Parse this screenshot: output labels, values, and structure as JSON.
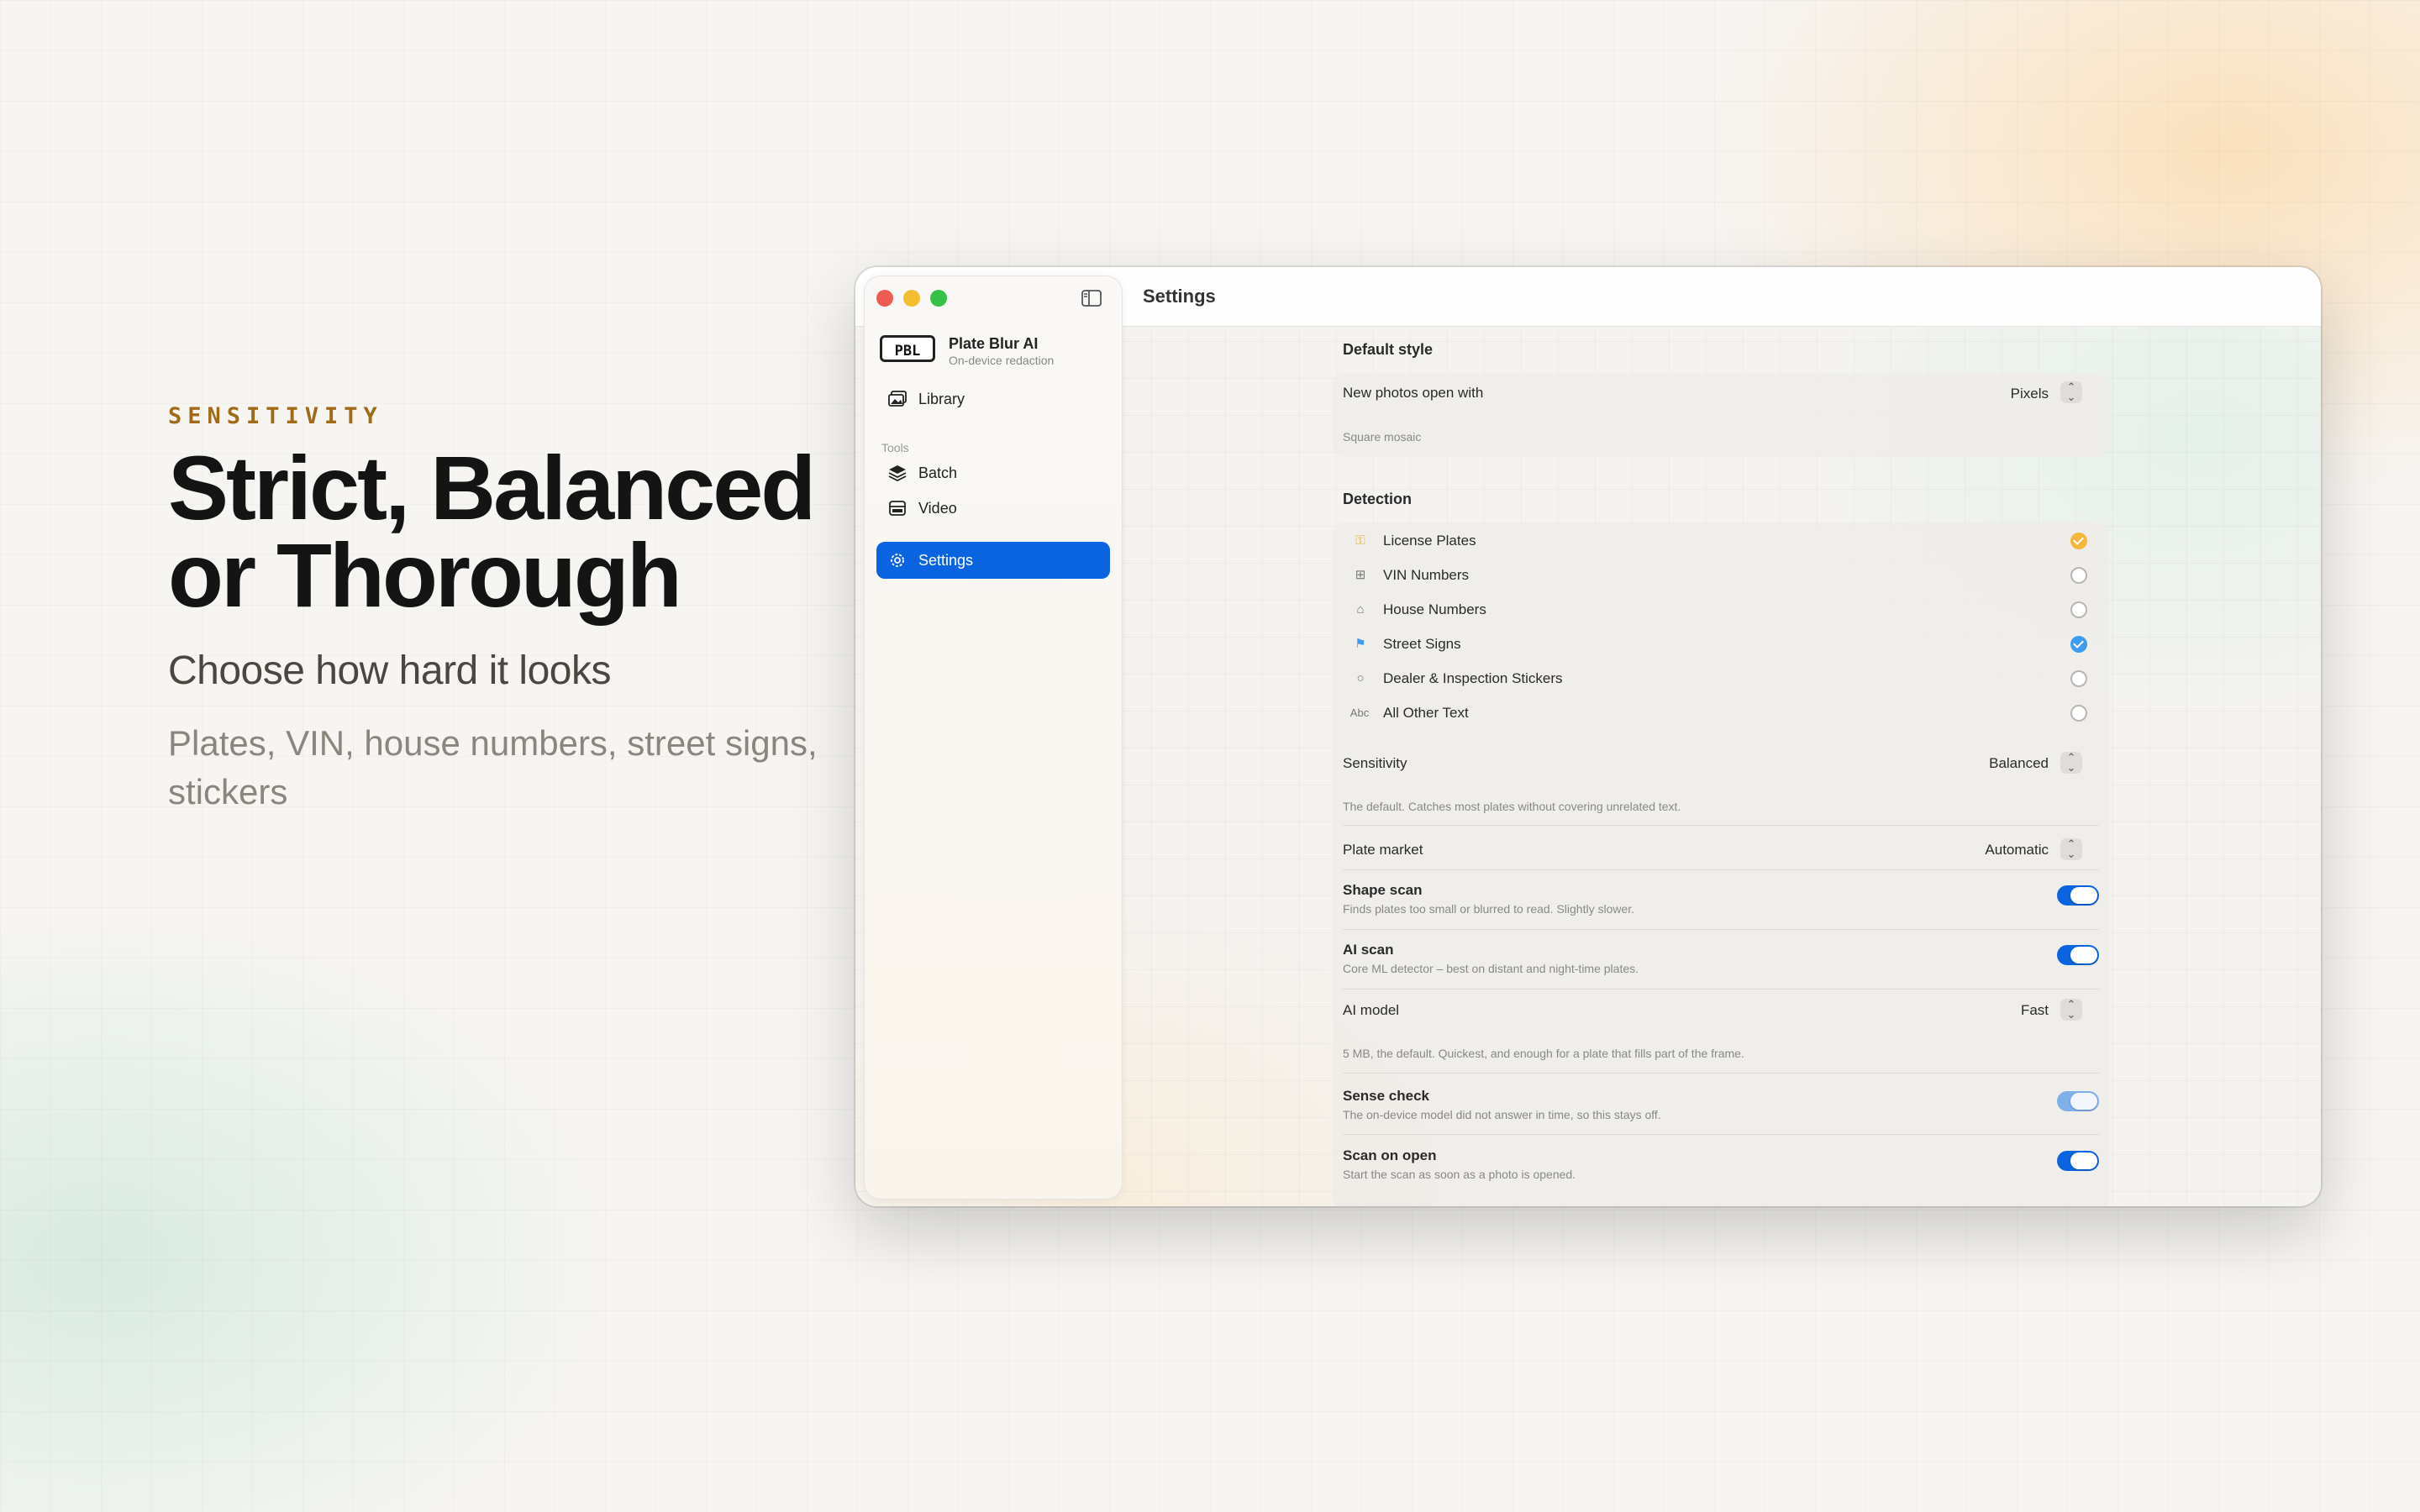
{
  "hero": {
    "eyebrow": "SENSITIVITY",
    "headline_line1": "Strict, Balanced",
    "headline_line2": "or Thorough",
    "subhead": "Choose how hard it looks",
    "body_line1": "Plates, VIN, house numbers, street signs,",
    "body_line2": "stickers"
  },
  "window": {
    "title": "Settings"
  },
  "sidebar": {
    "brand_logo": "PBL",
    "brand_name": "Plate Blur AI",
    "brand_sub": "On-device redaction",
    "items": [
      {
        "label": "Library",
        "icon": "photo-library-icon"
      },
      {
        "label": "Batch",
        "icon": "stack-icon"
      },
      {
        "label": "Video",
        "icon": "video-icon"
      },
      {
        "label": "Settings",
        "icon": "gear-icon",
        "active": true
      }
    ],
    "section_tools": "Tools"
  },
  "settings": {
    "default_style": {
      "title": "Default style",
      "new_photos_label": "New photos open with",
      "new_photos_value": "Pixels",
      "new_photos_desc": "Square mosaic"
    },
    "detection": {
      "title": "Detection",
      "items": [
        {
          "label": "License Plates",
          "icon": "plate-icon",
          "state": "checked-orange"
        },
        {
          "label": "VIN Numbers",
          "icon": "hash-icon",
          "state": "off"
        },
        {
          "label": "House Numbers",
          "icon": "house-icon",
          "state": "off"
        },
        {
          "label": "Street Signs",
          "icon": "signpost-icon",
          "state": "checked-blue"
        },
        {
          "label": "Dealer & Inspection Stickers",
          "icon": "circle-icon",
          "state": "off"
        },
        {
          "label": "All Other Text",
          "icon": "abc-icon",
          "state": "off"
        }
      ],
      "sensitivity_label": "Sensitivity",
      "sensitivity_value": "Balanced",
      "sensitivity_desc": "The default. Catches most plates without covering unrelated text.",
      "plate_market_label": "Plate market",
      "plate_market_value": "Automatic",
      "shape_scan_label": "Shape scan",
      "shape_scan_desc": "Finds plates too small or blurred to read. Slightly slower.",
      "shape_scan_on": true,
      "ai_scan_label": "AI scan",
      "ai_scan_desc": "Core ML detector – best on distant and night-time plates.",
      "ai_scan_on": true,
      "ai_model_label": "AI model",
      "ai_model_value": "Fast",
      "ai_model_desc": "5 MB, the default. Quickest, and enough for a plate that fills part of the frame.",
      "sense_check_label": "Sense check",
      "sense_check_desc": "The on-device model did not answer in time, so this stays off.",
      "sense_check_on": true,
      "scan_on_open_label": "Scan on open",
      "scan_on_open_desc": "Start the scan as soon as a photo is opened.",
      "scan_on_open_on": true
    }
  },
  "colors": {
    "accent": "#0a64e0",
    "eyebrow": "#a06a18",
    "check_orange": "#f5b83a",
    "check_blue": "#3c9cf0"
  }
}
